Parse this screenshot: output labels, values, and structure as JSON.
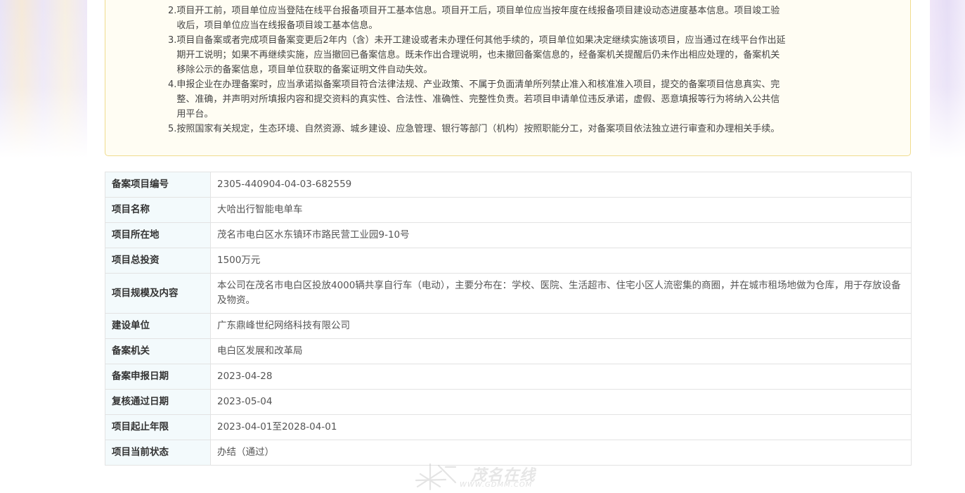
{
  "notice": {
    "items": [
      {
        "num": "2.",
        "text": "项目开工前，项目单位应当登陆在线平台报备项目开工基本信息。项目开工后，项目单位应当按年度在线报备项目建设动态进度基本信息。项目竣工验收后，项目单位应当在线报备项目竣工基本信息。"
      },
      {
        "num": "3.",
        "text": "项目自备案或者完成项目备案变更后2年内（含）未开工建设或者未办理任何其他手续的，项目单位如果决定继续实施该项目，应当通过在线平台作出延期开工说明；如果不再继续实施，应当撤回已备案信息。既未作出合理说明，也未撤回备案信息的，经备案机关提醒后仍未作出相应处理的，备案机关移除公示的备案信息，项目单位获取的备案证明文件自动失效。"
      },
      {
        "num": "4.",
        "text": "申报企业在办理备案时，应当承诺拟备案项目符合法律法规、产业政策、不属于负面清单所列禁止准入和核准准入项目，提交的备案项目信息真实、完整、准确，并声明对所填报内容和提交资料的真实性、合法性、准确性、完整性负责。若项目申请单位违反承诺，虚假、恶意填报等行为将纳入公共信用平台。"
      },
      {
        "num": "5.",
        "text": "按照国家有关规定，生态环境、自然资源、城乡建设、应急管理、银行等部门（机构）按照职能分工，对备案项目依法独立进行审查和办理相关手续。"
      }
    ]
  },
  "table": {
    "rows": [
      {
        "label": "备案项目编号",
        "value": "2305-440904-04-03-682559"
      },
      {
        "label": "项目名称",
        "value": "大哈出行智能电单车"
      },
      {
        "label": "项目所在地",
        "value": "茂名市电白区水东镇环市路民营工业园9-10号"
      },
      {
        "label": "项目总投资",
        "value": "1500万元"
      },
      {
        "label": "项目规模及内容",
        "value": "本公司在茂名市电白区投放4000辆共享自行车（电动），主要分布在：学校、医院、生活超市、住宅小区人流密集的商圈，并在城市租场地做为仓库，用于存放设备及物资。"
      },
      {
        "label": "建设单位",
        "value": "广东鼎峰世纪网络科技有限公司"
      },
      {
        "label": "备案机关",
        "value": "电白区发展和改革局"
      },
      {
        "label": "备案申报日期",
        "value": "2023-04-28"
      },
      {
        "label": "复核通过日期",
        "value": "2023-05-04"
      },
      {
        "label": "项目起止年限",
        "value": "2023-04-01至2028-04-01"
      },
      {
        "label": "项目当前状态",
        "value": "办结（通过）"
      }
    ]
  },
  "watermark": {
    "brand": "茂名在线",
    "url": "WWW.GDMM.COM",
    "logo_icon": "starburst-logo-icon"
  }
}
